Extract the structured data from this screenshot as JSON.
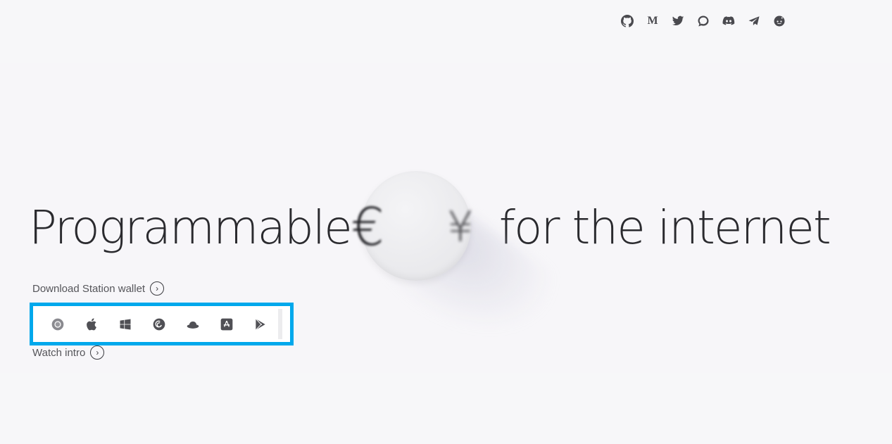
{
  "social": {
    "items": [
      {
        "icon": "github-icon"
      },
      {
        "icon": "medium-icon",
        "glyph": "M"
      },
      {
        "icon": "twitter-icon"
      },
      {
        "icon": "chat-bubble-icon"
      },
      {
        "icon": "discord-icon"
      },
      {
        "icon": "telegram-icon"
      },
      {
        "icon": "reddit-icon"
      }
    ]
  },
  "hero": {
    "headline_start": "Programmable",
    "currency_glyph": "€",
    "currency_glyph_trailing": "¥",
    "headline_end": "for the internet"
  },
  "download": {
    "label": "Download Station wallet",
    "arrow": "›"
  },
  "platforms": [
    {
      "icon": "chrome-icon"
    },
    {
      "icon": "apple-icon"
    },
    {
      "icon": "windows-icon"
    },
    {
      "icon": "debian-icon"
    },
    {
      "icon": "redhat-icon"
    },
    {
      "icon": "app-store-icon"
    },
    {
      "icon": "google-play-icon"
    }
  ],
  "watch": {
    "label": "Watch intro",
    "arrow": "›"
  },
  "colors": {
    "highlight_border": "#00a8ec",
    "background": "#f7f7f9",
    "text": "#2a2a2e",
    "icon": "#4a4a4f"
  }
}
